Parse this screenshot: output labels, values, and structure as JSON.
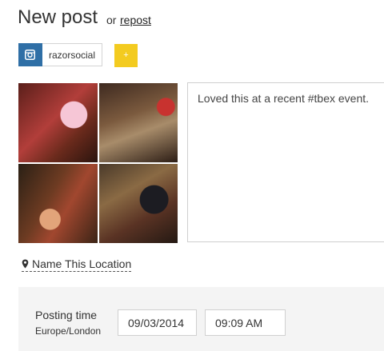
{
  "header": {
    "title": "New post",
    "or_text": "or",
    "repost_link": "repost"
  },
  "account": {
    "network_icon": "instagram-icon",
    "name": "razorsocial",
    "add_label": "+"
  },
  "media": {
    "photos": [
      "photo-1",
      "photo-2",
      "photo-3",
      "photo-4"
    ]
  },
  "caption": {
    "text": "Loved this at a recent #tbex event."
  },
  "location": {
    "icon": "map-pin-icon",
    "label": "Name This Location"
  },
  "scheduling": {
    "label": "Posting time",
    "timezone": "Europe/London",
    "date": "09/03/2014",
    "time": "09:09 AM"
  },
  "colors": {
    "accent_blue": "#2f6fa6",
    "accent_yellow": "#f3cb20",
    "panel_bg": "#f4f4f4"
  }
}
